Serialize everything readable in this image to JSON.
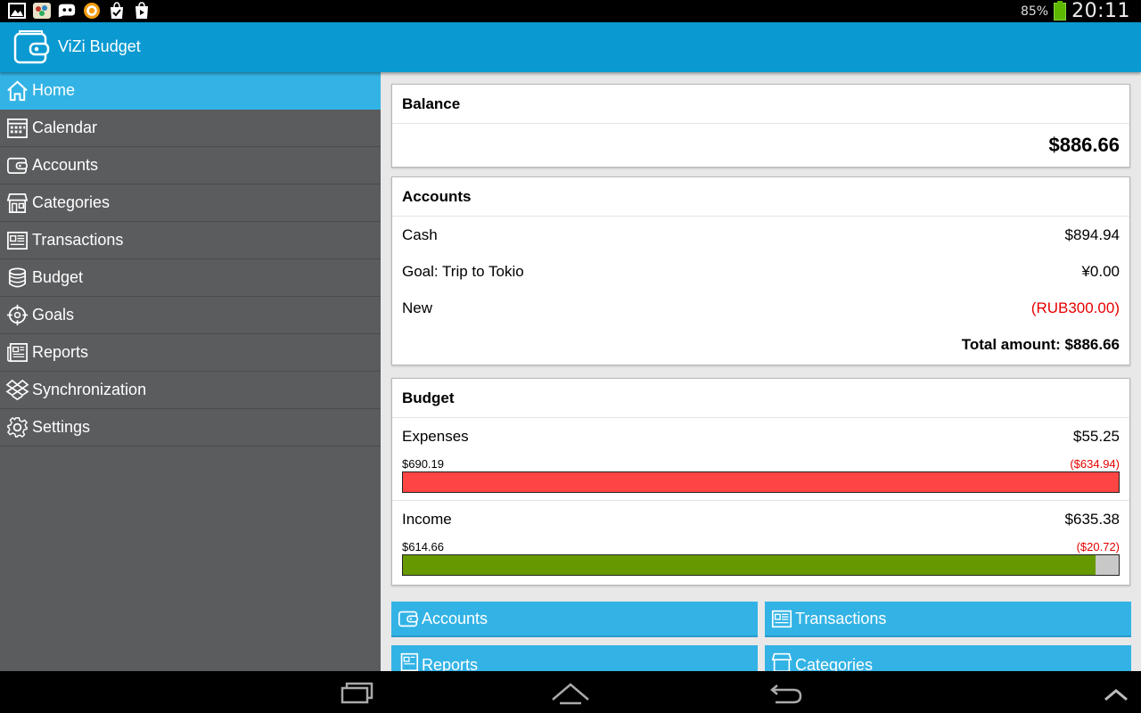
{
  "status_bar": {
    "battery": "85%",
    "time": "20:11",
    "battery_color": "#5cb800"
  },
  "app": {
    "title": "ViZi Budget",
    "accent": "#0a9ad1",
    "icon": "wallet-icon"
  },
  "sidebar": {
    "items": [
      {
        "label": "Home",
        "icon": "home-icon",
        "active": true
      },
      {
        "label": "Calendar",
        "icon": "calendar-icon"
      },
      {
        "label": "Accounts",
        "icon": "wallet-icon"
      },
      {
        "label": "Categories",
        "icon": "store-icon"
      },
      {
        "label": "Transactions",
        "icon": "receipt-icon"
      },
      {
        "label": "Budget",
        "icon": "database-icon"
      },
      {
        "label": "Goals",
        "icon": "target-icon"
      },
      {
        "label": "Reports",
        "icon": "newspaper-icon"
      },
      {
        "label": "Synchronization",
        "icon": "dropbox-icon"
      },
      {
        "label": "Settings",
        "icon": "gear-icon"
      }
    ]
  },
  "balance": {
    "title": "Balance",
    "amount": "$886.66"
  },
  "accounts": {
    "title": "Accounts",
    "rows": [
      {
        "name": "Cash",
        "amount": "$894.94"
      },
      {
        "name": "Goal: Trip to Tokio",
        "amount": "¥0.00"
      },
      {
        "name": "New",
        "amount": "(RUB300.00)",
        "negative": true
      }
    ],
    "total": "Total amount: $886.66"
  },
  "budget": {
    "title": "Budget",
    "expenses": {
      "label": "Expenses",
      "amount": "$55.25",
      "planned": "$690.19",
      "remaining": "($634.94)",
      "fill_fraction": 1.0,
      "color": "#ff4444"
    },
    "income": {
      "label": "Income",
      "amount": "$635.38",
      "planned": "$614.66",
      "remaining": "($20.72)",
      "fill_fraction": 0.967,
      "color": "#669900"
    }
  },
  "shortcuts": {
    "accounts": "Accounts",
    "transactions": "Transactions",
    "reports": "Reports",
    "categories": "Categories"
  }
}
